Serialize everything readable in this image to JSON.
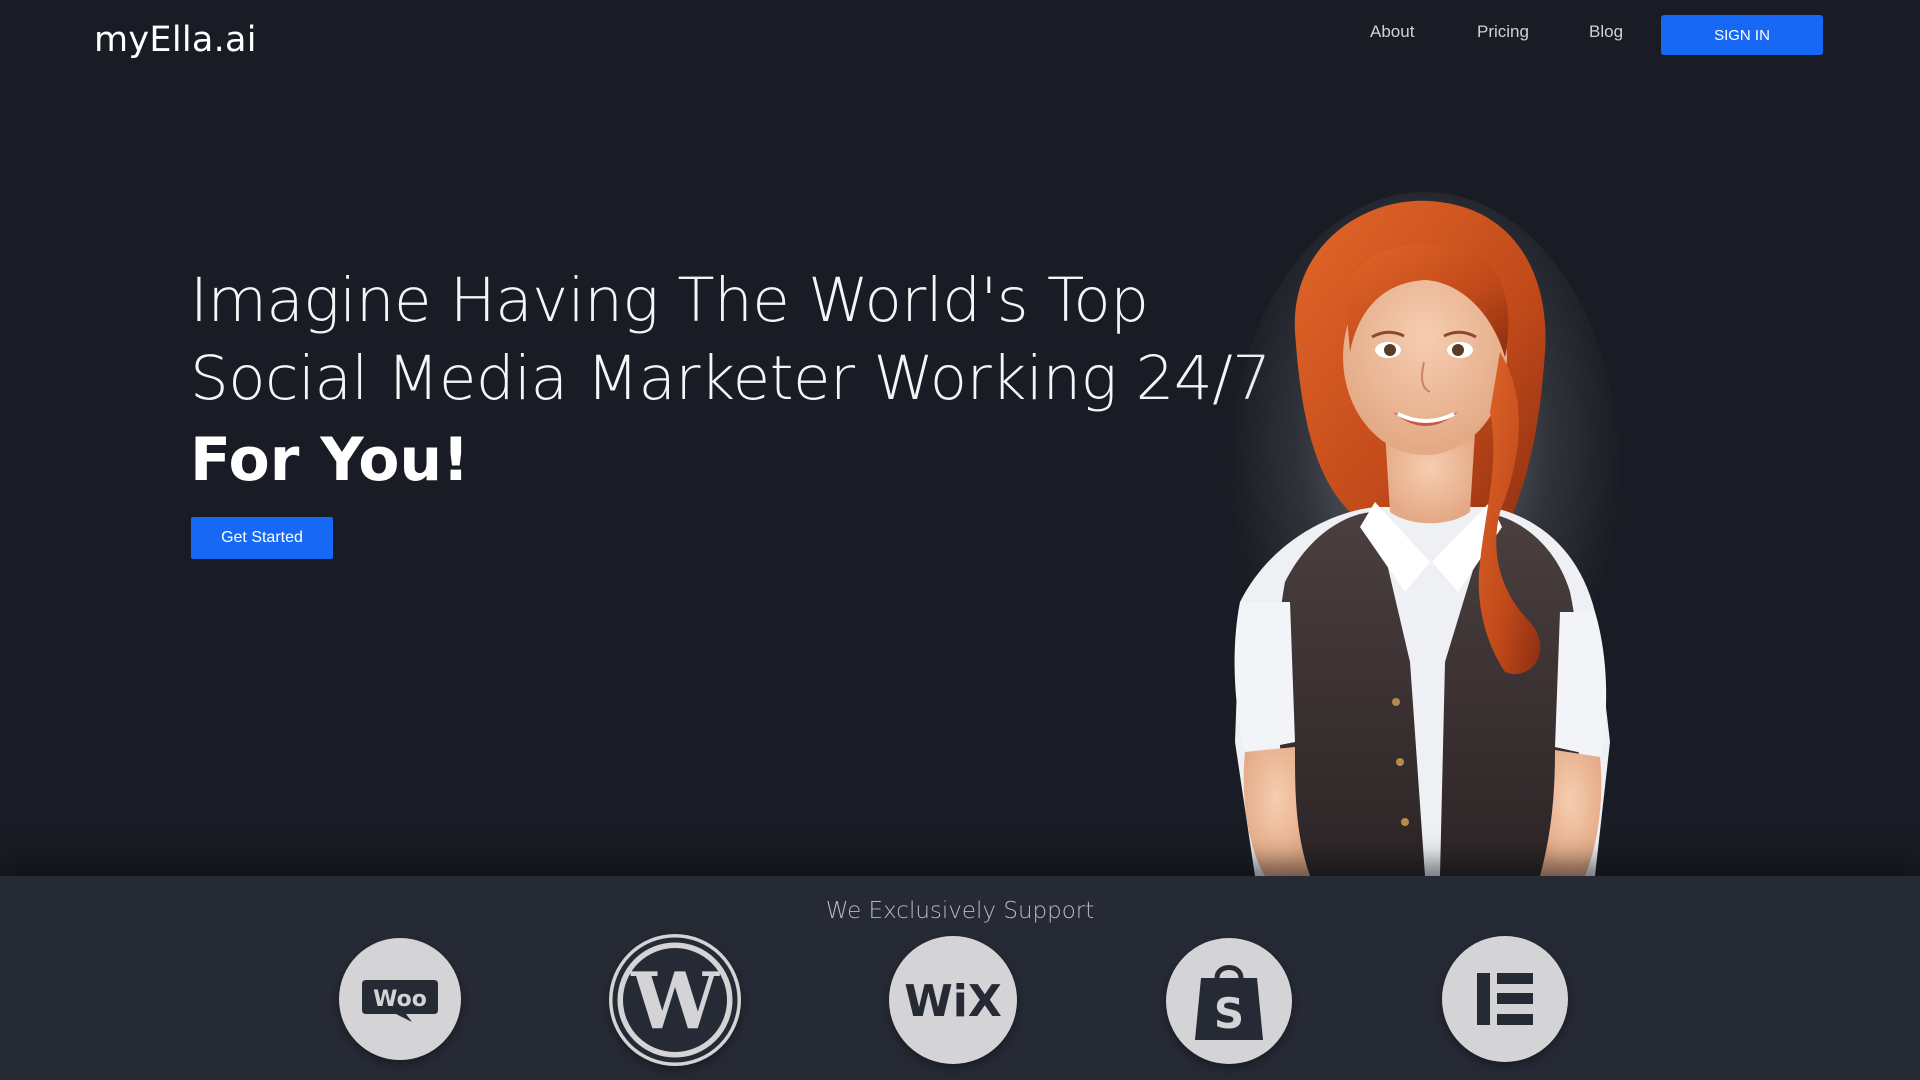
{
  "brand": {
    "logo_text": "myElla.ai"
  },
  "nav": {
    "items": [
      {
        "label": "About"
      },
      {
        "label": "Pricing"
      },
      {
        "label": "Blog"
      }
    ],
    "signin_label": "SIGN IN"
  },
  "hero": {
    "headline_line1": "Imagine Having The World's Top",
    "headline_line2": "Social Media Marketer Working 24/7",
    "headline_bold": "For You!",
    "cta_label": "Get Started"
  },
  "support": {
    "title": "We Exclusively Support",
    "platforms": [
      {
        "name": "WooCommerce",
        "icon": "woocommerce-icon",
        "glyph": "Woo"
      },
      {
        "name": "WordPress",
        "icon": "wordpress-icon",
        "glyph": "W"
      },
      {
        "name": "Wix",
        "icon": "wix-icon",
        "glyph": "WiX"
      },
      {
        "name": "Shopify",
        "icon": "shopify-icon",
        "glyph": "S"
      },
      {
        "name": "Elementor",
        "icon": "elementor-icon",
        "glyph": "E"
      }
    ]
  },
  "colors": {
    "background": "#191c24",
    "strip": "#262a35",
    "accent": "#1768f5",
    "icon_bg": "#d4d4d6",
    "icon_fg": "#262a35"
  }
}
